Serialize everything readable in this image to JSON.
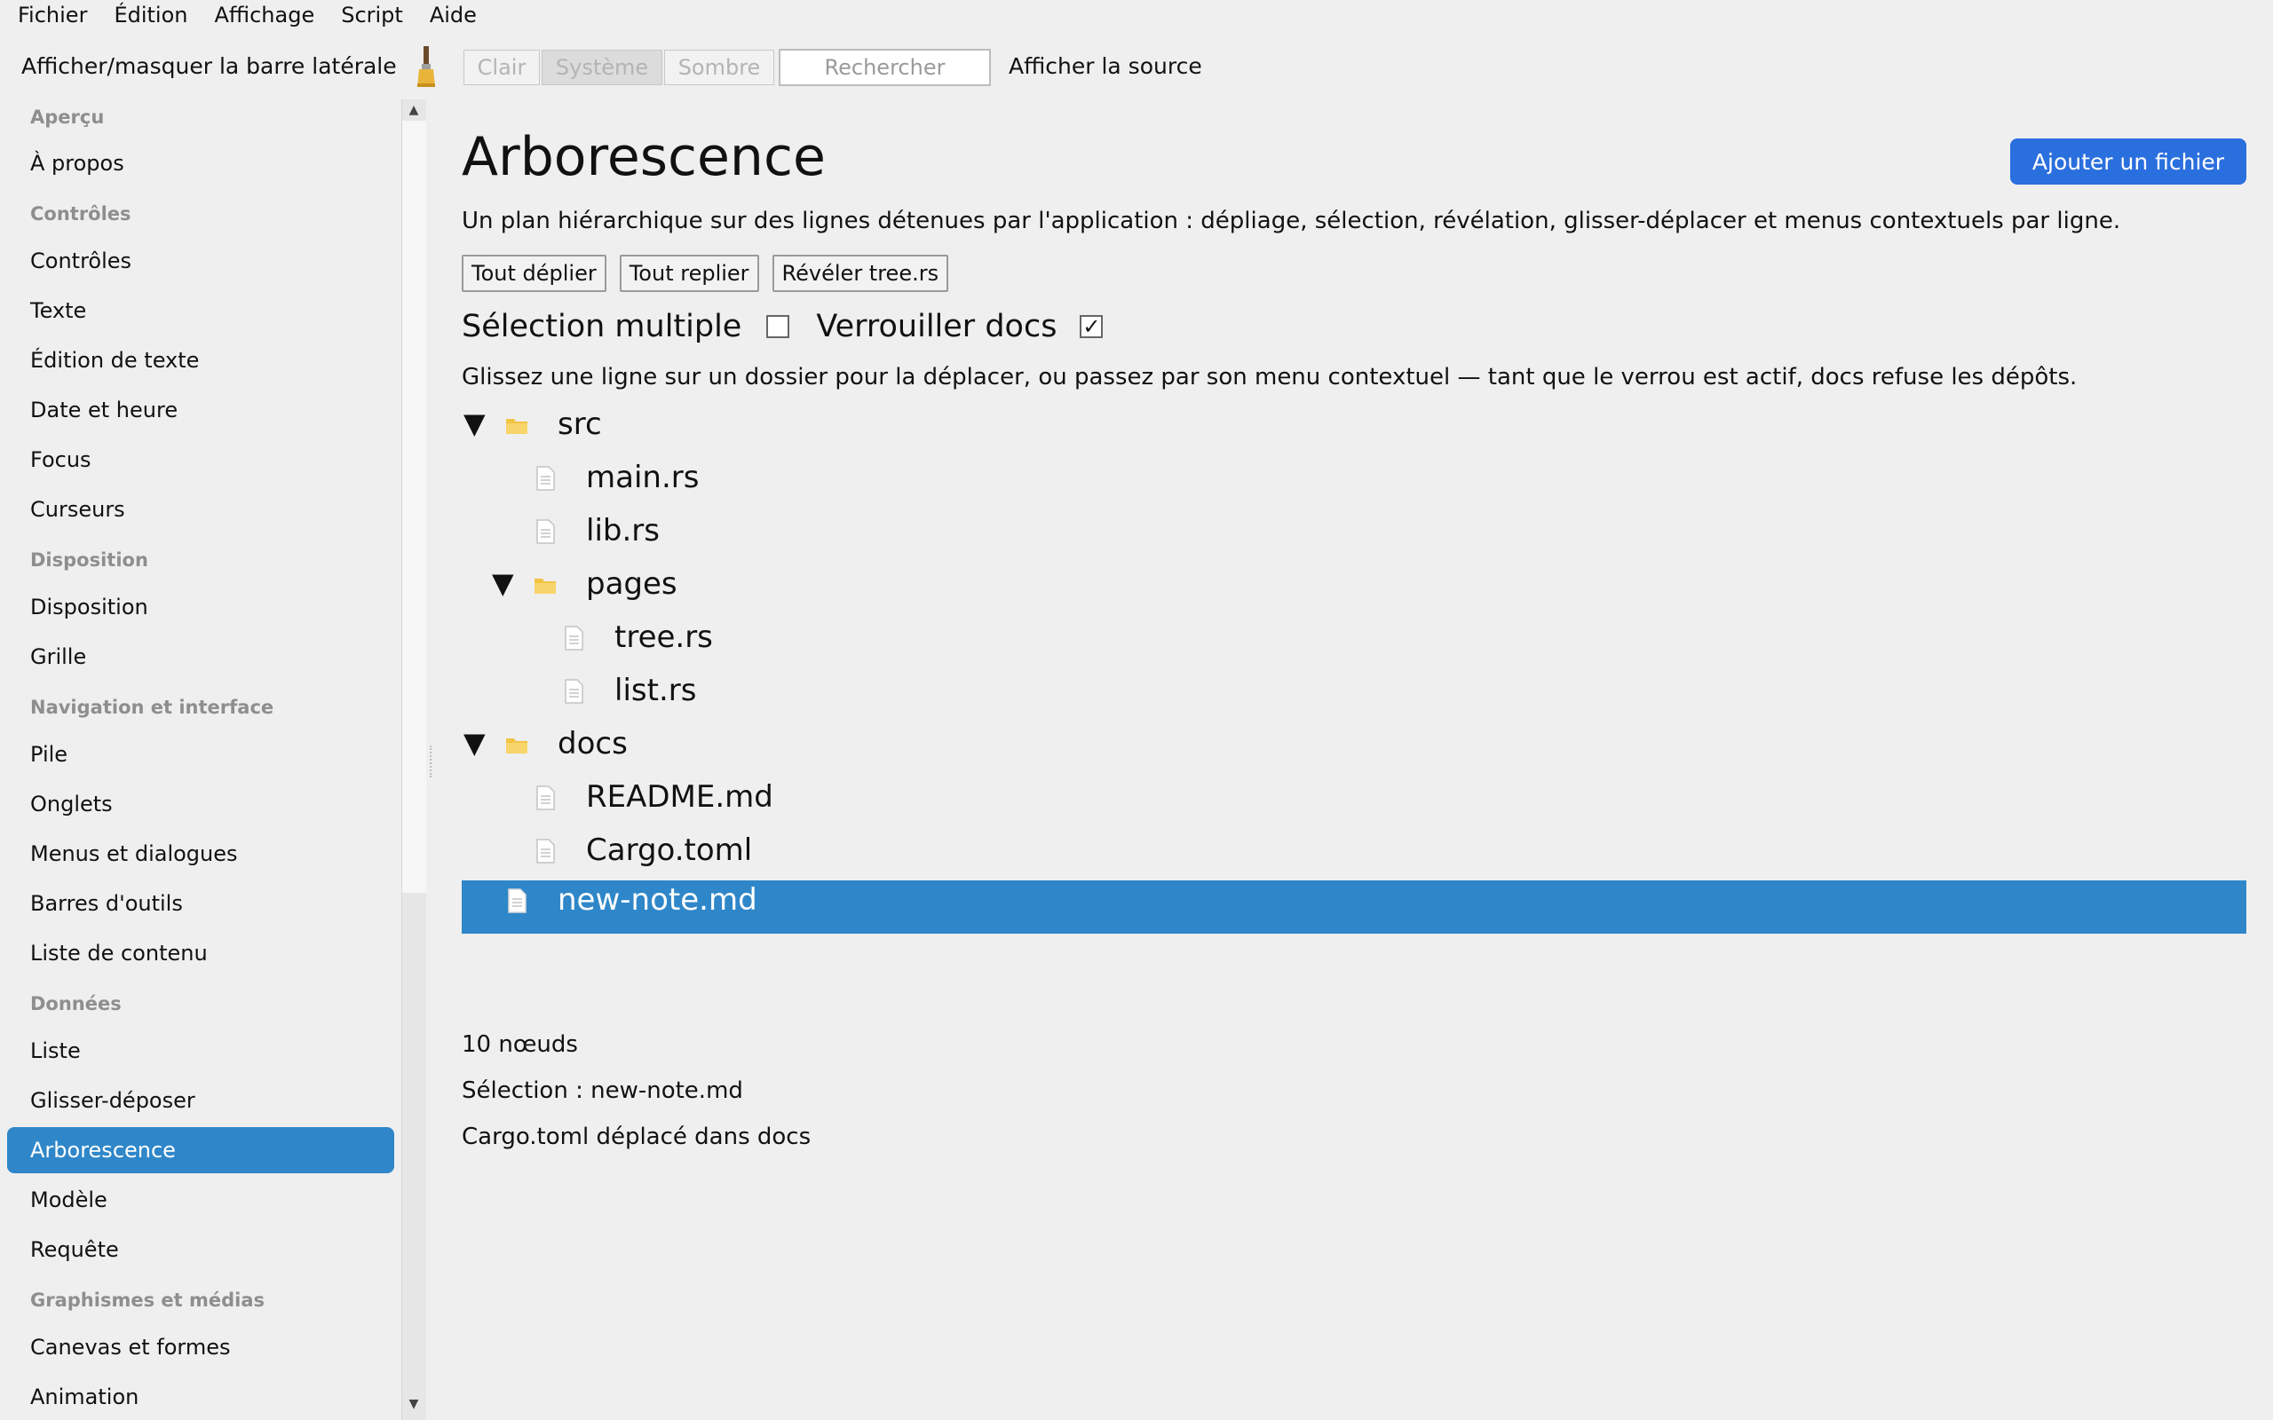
{
  "menubar": {
    "items": [
      "Fichier",
      "Édition",
      "Affichage",
      "Script",
      "Aide"
    ]
  },
  "toolbar": {
    "toggle_sidebar": "Afficher/masquer la barre latérale",
    "theme": {
      "light": "Clair",
      "system": "Système",
      "dark": "Sombre",
      "selected": "Système"
    },
    "search_placeholder": "Rechercher",
    "show_source": "Afficher la source"
  },
  "sidebar": {
    "sections": {
      "apercu": "Aperçu",
      "controles": "Contrôles",
      "disposition": "Disposition",
      "navigation": "Navigation et interface",
      "donnees": "Données",
      "graphismes": "Graphismes et médias"
    },
    "items": {
      "a_propos": "À propos",
      "controles": "Contrôles",
      "texte": "Texte",
      "edition_texte": "Édition de texte",
      "date_heure": "Date et heure",
      "focus": "Focus",
      "curseurs": "Curseurs",
      "disposition": "Disposition",
      "grille": "Grille",
      "pile": "Pile",
      "onglets": "Onglets",
      "menus": "Menus et dialogues",
      "barres_outils": "Barres d'outils",
      "liste_contenu": "Liste de contenu",
      "liste": "Liste",
      "glisser_deposer": "Glisser-déposer",
      "arborescence": "Arborescence",
      "modele": "Modèle",
      "requete": "Requête",
      "canevas": "Canevas et formes",
      "animation": "Animation"
    },
    "selected": "Arborescence"
  },
  "main": {
    "title": "Arborescence",
    "add_file": "Ajouter un fichier",
    "description": "Un plan hiérarchique sur des lignes détenues par l'application : dépliage, sélection, révélation, glisser-déplacer et menus contextuels par ligne.",
    "buttons": {
      "expand_all": "Tout déplier",
      "collapse_all": "Tout replier",
      "reveal": "Révéler tree.rs"
    },
    "options": {
      "multi_select": "Sélection multiple",
      "multi_select_checked": false,
      "lock_docs": "Verrouiller docs",
      "lock_docs_checked": true,
      "check_mark": "✓"
    },
    "hint": "Glissez une ligne sur un dossier pour la déplacer, ou passez par son menu contextuel — tant que le verrou est actif, docs refuse les dépôts.",
    "tree": {
      "disclosure_glyph": "▼",
      "src": "src",
      "main_rs": "main.rs",
      "lib_rs": "lib.rs",
      "pages": "pages",
      "tree_rs": "tree.rs",
      "list_rs": "list.rs",
      "docs": "docs",
      "readme": "README.md",
      "cargo": "Cargo.toml",
      "new_note": "new-note.md"
    },
    "status": {
      "count": "10 nœuds",
      "selection": "Sélection : new-note.md",
      "last_action": "Cargo.toml déplacé dans docs"
    }
  },
  "colors": {
    "accent": "#2f87c9",
    "primary_button": "#2a6fde",
    "folder": "#f2c344"
  },
  "icons": {
    "folder": "folder-icon",
    "file": "file-icon",
    "brush": "paintbrush-icon"
  }
}
